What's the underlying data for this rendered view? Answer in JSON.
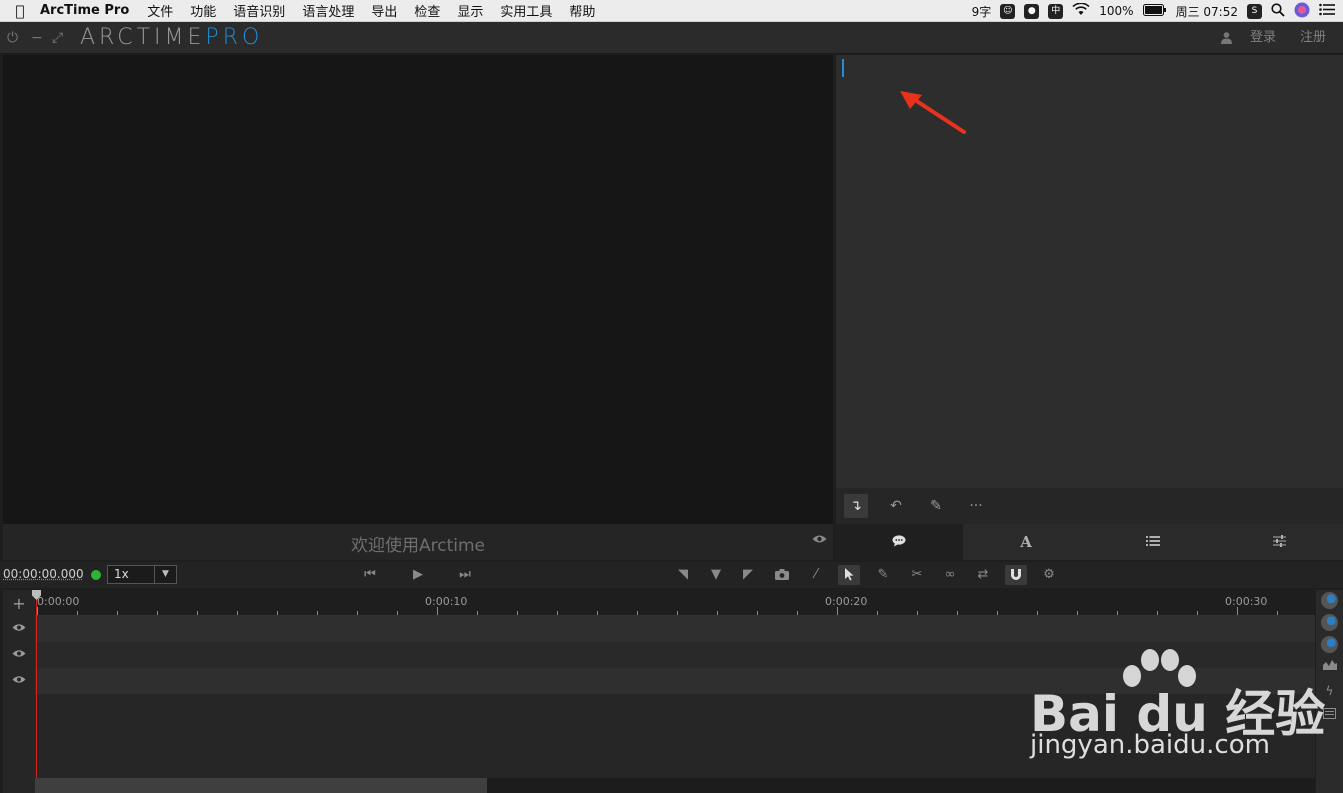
{
  "menubar": {
    "app_name": "ArcTime Pro",
    "items": [
      "文件",
      "功能",
      "语音识别",
      "语言处理",
      "导出",
      "检查",
      "显示",
      "实用工具",
      "帮助"
    ],
    "status": {
      "input_method": "9字",
      "ime_cn": "中",
      "battery": "100%",
      "clock": "周三 07:52"
    }
  },
  "titlebar": {
    "logo_main": "ARCTIME",
    "logo_accent": "PRO",
    "login": "登录",
    "register": "注册",
    "accent_color": "#1f8fd6"
  },
  "video": {
    "welcome_text": "欢迎使用Arctime"
  },
  "editor": {
    "tabs": [
      {
        "icon": "speech-bubble-icon",
        "active": true
      },
      {
        "icon": "font-icon",
        "glyph": "A",
        "active": false
      },
      {
        "icon": "list-icon",
        "active": false
      },
      {
        "icon": "sliders-icon",
        "active": false
      }
    ]
  },
  "transport": {
    "timecode": "00:00:00.000",
    "speed": "1x"
  },
  "timeline": {
    "labels": [
      "0:00:00",
      "0:00:10",
      "0:00:20",
      "0:00:30"
    ],
    "label_seconds": [
      0,
      10,
      20,
      30
    ]
  },
  "watermark": {
    "brand": "Bai du 经验",
    "url": "jingyan.baidu.com"
  }
}
